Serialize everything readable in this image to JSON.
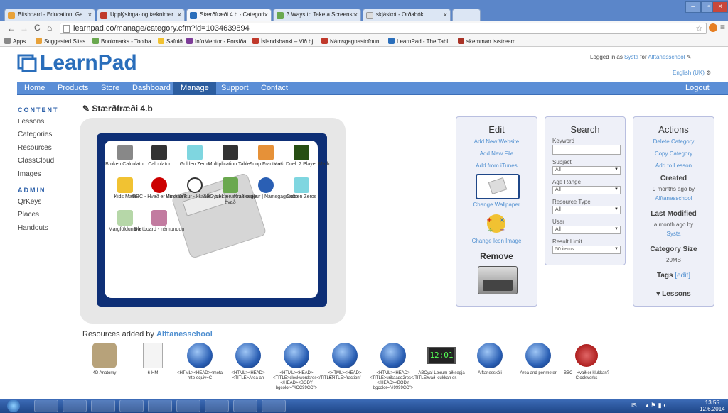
{
  "browser": {
    "tabs": [
      "Bitsboard - Education, Ga",
      "Upplýsinga- og tæknimer",
      "Stærðfræði 4.b - Categori",
      "3 Ways to Take a Screensh",
      "skjáskot - Orðabók"
    ],
    "url": "learnpad.co/manage/category.cfm?id=1034639894",
    "bookmarks": [
      "Apps",
      "Suggested Sites",
      "Bookmarks - Toolba...",
      "Safnið",
      "InfoMentor - Forsíða",
      "Íslandsbanki – Við bj...",
      "Námsgagnastofnun ...",
      "LearnPad - The Tabl...",
      "skemman.is/stream..."
    ]
  },
  "header": {
    "logo": "LearnPad",
    "logged_prefix": "Logged in as ",
    "user": "Systa",
    "logged_mid": " for ",
    "school": "Alftanesschool",
    "language": "English (UK)"
  },
  "nav": [
    "Home",
    "Products",
    "Store",
    "Dashboard",
    "Manage",
    "Support",
    "Contact"
  ],
  "logout": "Logout",
  "sidebar": {
    "content_heading": "CONTENT",
    "content_items": [
      "Lessons",
      "Categories",
      "Resources",
      "ClassCloud",
      "Images"
    ],
    "admin_heading": "ADMIN",
    "admin_items": [
      "QrKeys",
      "Places",
      "Handouts"
    ]
  },
  "page_title": "Stærðfræði 4.b",
  "tablet_apps": [
    "Broken Calculator",
    "Calculator",
    "Golden Zeros",
    "Multiplication Tables",
    "Coop Fractions",
    "Math Duel: 2 Player Math",
    "Kids Math",
    "BBC - Hvað er klukkan?",
    "Minnisleikur - klukka - tveir",
    "ABCya! Lærum að segja hvað",
    "Krakkasíður | Námsgagnasto",
    "Golden Zeros",
    "Margföldunarle",
    "Dartboard - námundun"
  ],
  "edit_panel": {
    "title": "Edit",
    "links": [
      "Add New Website",
      "Add New File",
      "Add from iTunes"
    ],
    "change_wallpaper": "Change Wallpaper",
    "change_icon": "Change Icon Image",
    "remove": "Remove"
  },
  "search_panel": {
    "title": "Search",
    "keyword_label": "Keyword",
    "keyword_value": "",
    "subject_label": "Subject",
    "subject_value": "All",
    "age_label": "Age Range",
    "age_value": "All",
    "restype_label": "Resource Type",
    "restype_value": "All",
    "user_label": "User",
    "user_value": "All",
    "limit_label": "Result Limit",
    "limit_value": "50 items"
  },
  "actions_panel": {
    "title": "Actions",
    "links": [
      "Delete Category",
      "Copy Category",
      "Add to Lesson"
    ],
    "created_label": "Created",
    "created_value": "9 months ago by",
    "created_by": "Alftanesschool",
    "modified_label": "Last Modified",
    "modified_value": "a month ago by",
    "modified_by": "Systa",
    "size_label": "Category Size",
    "size_value": "20MB",
    "tags_label": "Tags",
    "tags_edit": "[edit]",
    "lessons": "▾ Lessons"
  },
  "resources": {
    "heading": "Resources added by ",
    "by": "Alftanesschool",
    "items": [
      "4D Anatomy",
      "6-HM",
      "<HTML><HEAD><meta http-equiv=C",
      "<HTML><HEAD><TITLE>Area an",
      "<HTML><HEAD><TITLE>clockwordsres</TITLE></HEAD><BODY bgcolor=\"#CC99CC\">",
      "<HTML><HEAD><TITLE>fractionf",
      "<HTML><HEAD><TITLE>urikaadd2res</TITLE></HEAD><BODY bgcolor=\"#9999CC\">",
      "ABCya! Lærum að segja hvað klukkan er.",
      "Álftanesskóli",
      "Area and perimeter",
      "BBC - Hvað er klukkan? Clockworks"
    ],
    "clock_text": "12:01"
  },
  "taskbar": {
    "time": "13:55",
    "date": "12.6.2014",
    "lang": "IS"
  }
}
